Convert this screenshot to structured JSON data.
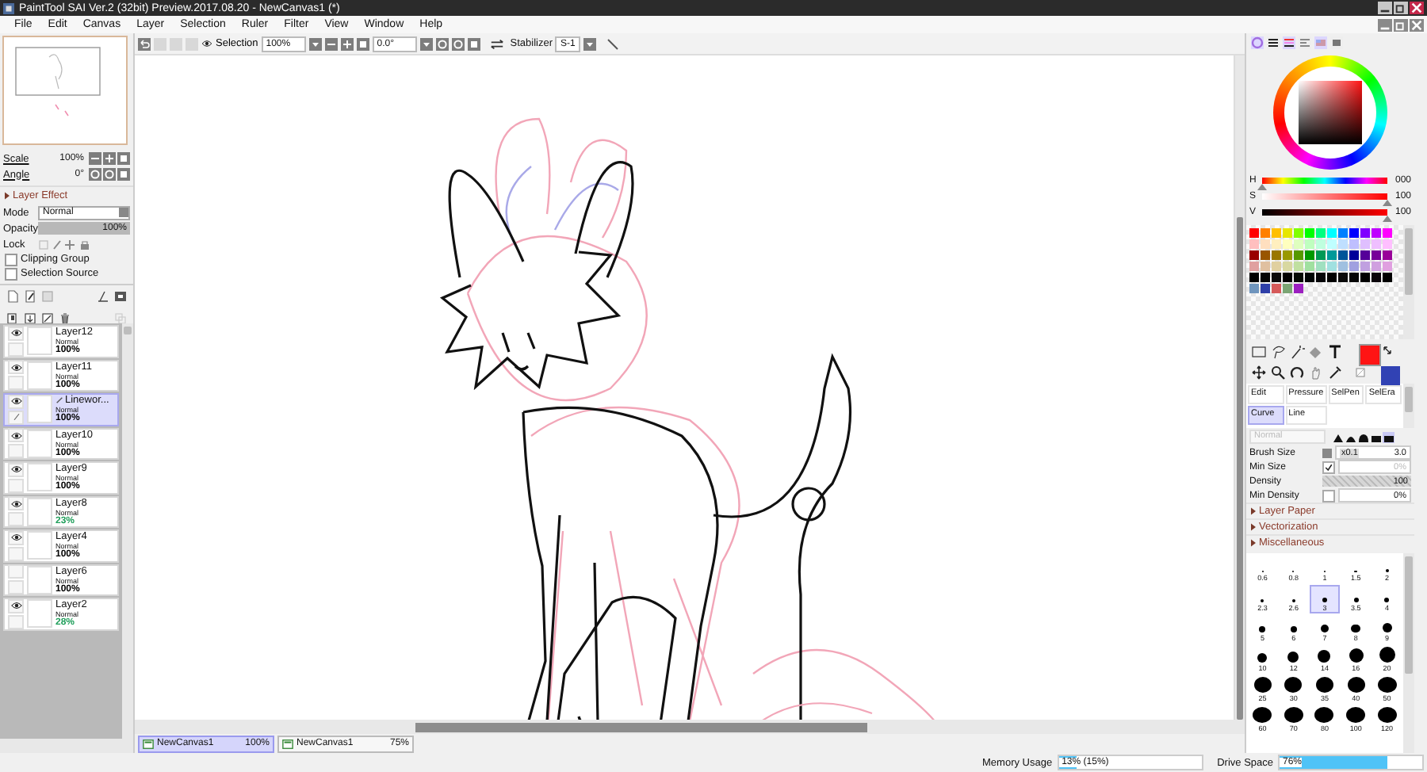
{
  "window": {
    "title": "PaintTool SAI Ver.2 (32bit) Preview.2017.08.20 - NewCanvas1 (*)"
  },
  "menu": [
    "File",
    "Edit",
    "Canvas",
    "Layer",
    "Selection",
    "Ruler",
    "Filter",
    "View",
    "Window",
    "Help"
  ],
  "navigator": {
    "scale": {
      "label": "Scale",
      "value": "100%"
    },
    "angle": {
      "label": "Angle",
      "value": "0°"
    }
  },
  "layer_effect": {
    "title": "Layer Effect",
    "expanded": false,
    "mode": {
      "label": "Mode",
      "value": "Normal"
    },
    "opacity": {
      "label": "Opacity",
      "value": "100%",
      "level": 1
    },
    "lock": {
      "label": "Lock"
    },
    "options": [
      {
        "label": "Clipping Group",
        "checked": false
      },
      {
        "label": "Selection Source",
        "checked": false
      }
    ]
  },
  "layers": [
    {
      "name": "Layer12",
      "mode": "Normal",
      "opacity": "100%",
      "color": "#000000",
      "kind": "normal",
      "visible": true,
      "selected": false
    },
    {
      "name": "Layer11",
      "mode": "Normal",
      "opacity": "100%",
      "color": "#000000",
      "kind": "normal",
      "visible": true,
      "selected": false
    },
    {
      "name": "Linewor...",
      "mode": "Normal",
      "opacity": "100%",
      "color": "#000000",
      "kind": "linework",
      "visible": true,
      "selected": true
    },
    {
      "name": "Layer10",
      "mode": "Normal",
      "opacity": "100%",
      "color": "#000000",
      "kind": "normal",
      "visible": true,
      "selected": false
    },
    {
      "name": "Layer9",
      "mode": "Normal",
      "opacity": "100%",
      "color": "#000000",
      "kind": "normal",
      "visible": true,
      "selected": false
    },
    {
      "name": "Layer8",
      "mode": "Normal",
      "opacity": "23%",
      "color": "#1f9e5a",
      "kind": "normal",
      "visible": true,
      "selected": false
    },
    {
      "name": "Layer4",
      "mode": "Normal",
      "opacity": "100%",
      "color": "#000000",
      "kind": "normal",
      "visible": true,
      "selected": false
    },
    {
      "name": "Layer6",
      "mode": "Normal",
      "opacity": "100%",
      "color": "#000000",
      "kind": "normal",
      "visible": false,
      "selected": false
    },
    {
      "name": "Layer2",
      "mode": "Normal",
      "opacity": "28%",
      "color": "#1f9e5a",
      "kind": "normal",
      "visible": true,
      "selected": false
    }
  ],
  "toolbar": {
    "selection": "Selection",
    "zoom": "100%",
    "angle": "0.0°",
    "stabilizer": {
      "label": "Stabilizer",
      "value": "S-1"
    }
  },
  "canvas_tabs": [
    {
      "name": "NewCanvas1",
      "zoom": "100%",
      "selected": true
    },
    {
      "name": "NewCanvas1",
      "zoom": "75%",
      "selected": false
    }
  ],
  "color": {
    "sliders": [
      {
        "label": "H",
        "value": "000",
        "level": 0
      },
      {
        "label": "S",
        "value": "100",
        "level": 1
      },
      {
        "label": "V",
        "value": "100",
        "level": 1
      }
    ],
    "foreground": {
      "color": "#ff1414"
    },
    "background": {
      "color": "#3142b4"
    }
  },
  "swatches": [
    {
      "color": "#ff0000"
    },
    {
      "color": "#ff8000"
    },
    {
      "color": "#ffbf00"
    },
    {
      "color": "#e6e600"
    },
    {
      "color": "#80ff00"
    },
    {
      "color": "#00ff00"
    },
    {
      "color": "#00ff80"
    },
    {
      "color": "#00ffff"
    },
    {
      "color": "#0080ff"
    },
    {
      "color": "#0000ff"
    },
    {
      "color": "#8000ff"
    },
    {
      "color": "#bf00ff"
    },
    {
      "color": "#ff00ff"
    },
    {
      "color": "#ffbfbf"
    },
    {
      "color": "#ffdfbf"
    },
    {
      "color": "#ffefbf"
    },
    {
      "color": "#ffffbf"
    },
    {
      "color": "#dfffbf"
    },
    {
      "color": "#bfffbf"
    },
    {
      "color": "#bfffdf"
    },
    {
      "color": "#bfffff"
    },
    {
      "color": "#bfdfff"
    },
    {
      "color": "#bfbfff"
    },
    {
      "color": "#dfbfff"
    },
    {
      "color": "#efbfff"
    },
    {
      "color": "#ffbfff"
    },
    {
      "color": "#990000"
    },
    {
      "color": "#995500"
    },
    {
      "color": "#997700"
    },
    {
      "color": "#999900"
    },
    {
      "color": "#559900"
    },
    {
      "color": "#009900"
    },
    {
      "color": "#009955"
    },
    {
      "color": "#009999"
    },
    {
      "color": "#005599"
    },
    {
      "color": "#000099"
    },
    {
      "color": "#550099"
    },
    {
      "color": "#770099"
    },
    {
      "color": "#990099"
    },
    {
      "color": "#e0a0a0"
    },
    {
      "color": "#e0c0a0"
    },
    {
      "color": "#e0d0a0"
    },
    {
      "color": "#d8d8a0"
    },
    {
      "color": "#c0e0a0"
    },
    {
      "color": "#a0e0a0"
    },
    {
      "color": "#a0e0c0"
    },
    {
      "color": "#a0e0e0"
    },
    {
      "color": "#a0c0e0"
    },
    {
      "color": "#a0a0e0"
    },
    {
      "color": "#c0a0e0"
    },
    {
      "color": "#d0a0e0"
    },
    {
      "color": "#e0a0e0"
    },
    {
      "color": "#000000"
    },
    {
      "color": "#050505"
    },
    {
      "color": "#0a0a0a"
    },
    {
      "color": "#000000"
    },
    {
      "color": "#050a05"
    },
    {
      "color": "#000505"
    },
    {
      "color": "#050508"
    },
    {
      "color": "#000000"
    },
    {
      "color": "#0a0a0a"
    },
    {
      "color": "#050505"
    },
    {
      "color": "#000000"
    },
    {
      "color": "#0a050a"
    },
    {
      "color": "#000000"
    },
    {
      "color": "#6f95bd"
    },
    {
      "color": "#2e3fa8"
    },
    {
      "color": "#d65a5a"
    },
    {
      "color": "#7ba574"
    },
    {
      "color": "#9b1fc0"
    }
  ],
  "brush_tabs": [
    {
      "label": "Edit",
      "selected": false
    },
    {
      "label": "Pressure",
      "selected": false
    },
    {
      "label": "SelPen",
      "selected": false
    },
    {
      "label": "SelEra",
      "selected": false
    },
    {
      "label": "Curve",
      "selected": true
    },
    {
      "label": "Line",
      "selected": false
    }
  ],
  "brush": {
    "mode": "Normal",
    "size": {
      "label": "Brush Size",
      "multiplier": "x0.1",
      "value": "3.0"
    },
    "min_size": {
      "label": "Min Size",
      "checked": true,
      "value": "0%",
      "disabled": true
    },
    "density": {
      "label": "Density",
      "value": "100",
      "level": 1
    },
    "min_density": {
      "label": "Min Density",
      "checked": false,
      "value": "0%"
    }
  },
  "sections": [
    {
      "label": "Layer Paper",
      "expanded": false
    },
    {
      "label": "Vectorization",
      "expanded": false
    },
    {
      "label": "Miscellaneous",
      "expanded": false
    }
  ],
  "brush_sizes": [
    {
      "label": "0.6",
      "selected": false
    },
    {
      "label": "0.8",
      "selected": false
    },
    {
      "label": "1",
      "selected": false
    },
    {
      "label": "1.5",
      "selected": false
    },
    {
      "label": "2",
      "selected": false
    },
    {
      "label": "2.3",
      "selected": false
    },
    {
      "label": "2.6",
      "selected": false
    },
    {
      "label": "3",
      "selected": true
    },
    {
      "label": "3.5",
      "selected": false
    },
    {
      "label": "4",
      "selected": false
    },
    {
      "label": "5",
      "selected": false
    },
    {
      "label": "6",
      "selected": false
    },
    {
      "label": "7",
      "selected": false
    },
    {
      "label": "8",
      "selected": false
    },
    {
      "label": "9",
      "selected": false
    },
    {
      "label": "10",
      "selected": false
    },
    {
      "label": "12",
      "selected": false
    },
    {
      "label": "14",
      "selected": false
    },
    {
      "label": "16",
      "selected": false
    },
    {
      "label": "20",
      "selected": false
    },
    {
      "label": "25",
      "selected": false
    },
    {
      "label": "30",
      "selected": false
    },
    {
      "label": "35",
      "selected": false
    },
    {
      "label": "40",
      "selected": false
    },
    {
      "label": "50",
      "selected": false
    },
    {
      "label": "60",
      "selected": false
    },
    {
      "label": "70",
      "selected": false
    },
    {
      "label": "80",
      "selected": false
    },
    {
      "label": "100",
      "selected": false
    },
    {
      "label": "120",
      "selected": false
    }
  ],
  "status": {
    "memory": {
      "label": "Memory Usage",
      "value": "13% (15%)",
      "level": 0.13
    },
    "drive": {
      "label": "Drive Space",
      "value": "76%",
      "level": 0.76
    }
  }
}
